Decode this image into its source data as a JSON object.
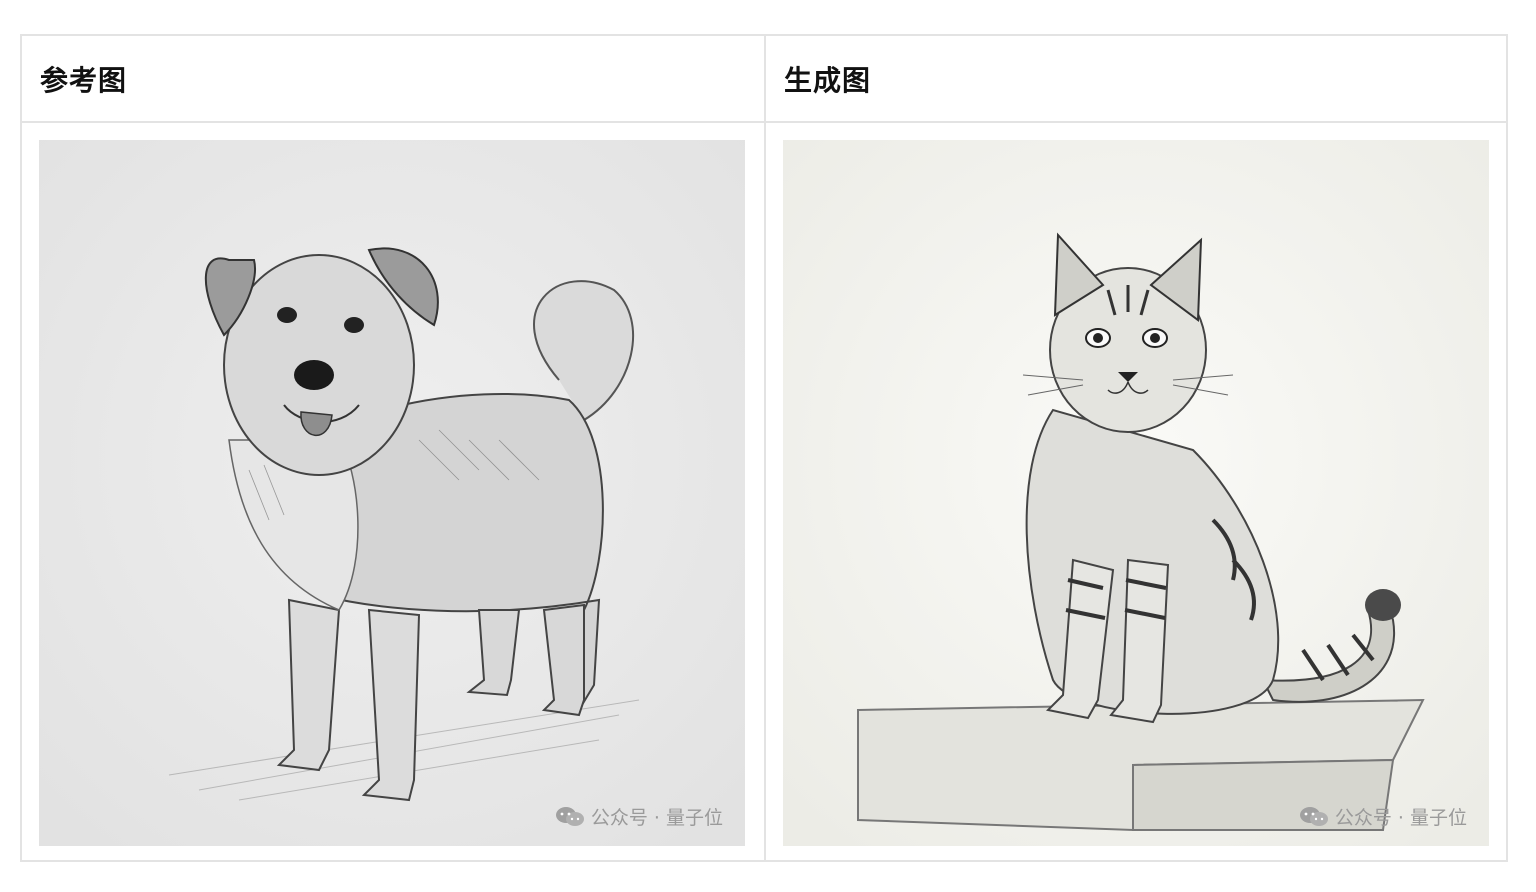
{
  "table": {
    "headers": {
      "left": "参考图",
      "right": "生成图"
    }
  },
  "images": {
    "left": {
      "watermark": "公众号 · 量子位"
    },
    "right": {
      "watermark": "公众号 · 量子位"
    }
  }
}
